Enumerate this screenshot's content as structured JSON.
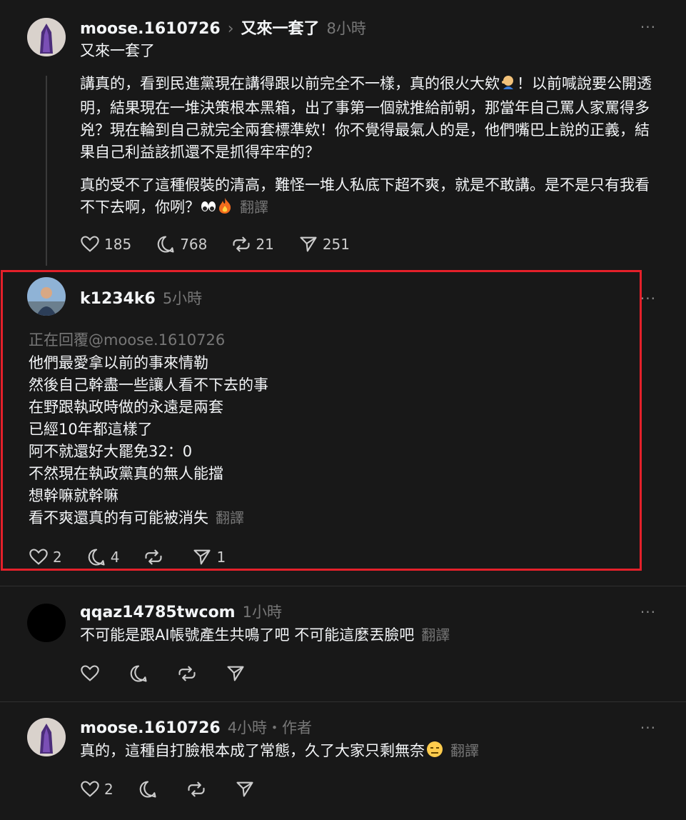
{
  "post1": {
    "username": "moose.1610726",
    "separator": "›",
    "thread_title": "又來一套了",
    "time": "8小時",
    "title_text": "又來一套了",
    "para1_a": "講真的，看到民進黨現在講得跟以前完全不一樣，真的很火大欸",
    "para1_b": "！以前喊說要公開透明，結果現在一堆決策根本黑箱，出了事第一個就推給前朝，那當年自己罵人家罵得多兇？現在輪到自己就完全兩套標準欸！你不覺得最氣人的是，他們嘴巴上說的正義，結果自己利益該抓還不是抓得牢牢的？",
    "para2": "真的受不了這種假裝的清高，難怪一堆人私底下超不爽，就是不敢講。是不是只有我看不下去啊，你咧？",
    "translate": "翻譯",
    "likes": "185",
    "comments": "768",
    "reposts": "21",
    "shares": "251"
  },
  "post2": {
    "username": "k1234k6",
    "time": "5小時",
    "reply_to": "正在回覆@moose.1610726",
    "lines": [
      "他們最愛拿以前的事來情勒",
      "然後自己幹盡一些讓人看不下去的事",
      "在野跟執政時做的永遠是兩套",
      "已經10年都這樣了",
      "阿不就還好大罷免32：0",
      "不然現在執政黨真的無人能擋",
      "想幹嘛就幹嘛",
      "看不爽還真的有可能被消失"
    ],
    "translate": "翻譯",
    "likes": "2",
    "comments": "4",
    "shares": "1"
  },
  "post3": {
    "username": "qqaz14785twcom",
    "time": "1小時",
    "text": "不可能是跟AI帳號產生共鳴了吧 不可能這麼丟臉吧",
    "translate": "翻譯"
  },
  "post4": {
    "username": "moose.1610726",
    "time": "4小時・作者",
    "text": "真的，這種自打臉根本成了常態，久了大家只剩無奈",
    "translate": "翻譯",
    "likes": "2"
  },
  "more_label": "···",
  "colors": {
    "background": "#181818",
    "highlight": "#e4202a",
    "muted": "#777777"
  }
}
